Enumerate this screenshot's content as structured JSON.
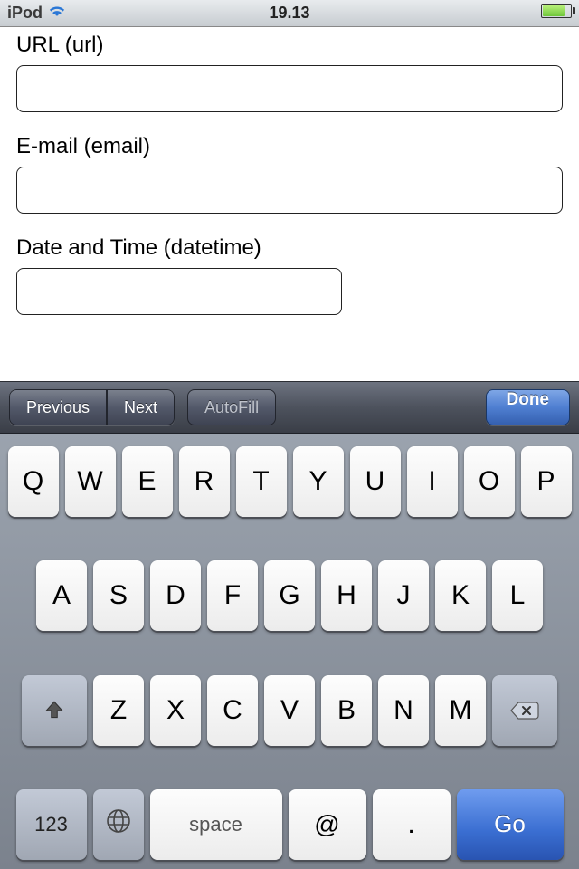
{
  "status": {
    "carrier": "iPod",
    "time": "19.13"
  },
  "form": {
    "url": {
      "label": "URL (url)",
      "value": ""
    },
    "email": {
      "label": "E-mail (email)",
      "value": ""
    },
    "datetime": {
      "label": "Date and Time (datetime)",
      "value": ""
    }
  },
  "accessory": {
    "previous": "Previous",
    "next": "Next",
    "autofill": "AutoFill",
    "done": "Done"
  },
  "keyboard": {
    "row1": [
      "Q",
      "W",
      "E",
      "R",
      "T",
      "Y",
      "U",
      "I",
      "O",
      "P"
    ],
    "row2": [
      "A",
      "S",
      "D",
      "F",
      "G",
      "H",
      "J",
      "K",
      "L"
    ],
    "row3": [
      "Z",
      "X",
      "C",
      "V",
      "B",
      "N",
      "M"
    ],
    "num": "123",
    "space": "space",
    "at": "@",
    "dot": ".",
    "go": "Go"
  }
}
